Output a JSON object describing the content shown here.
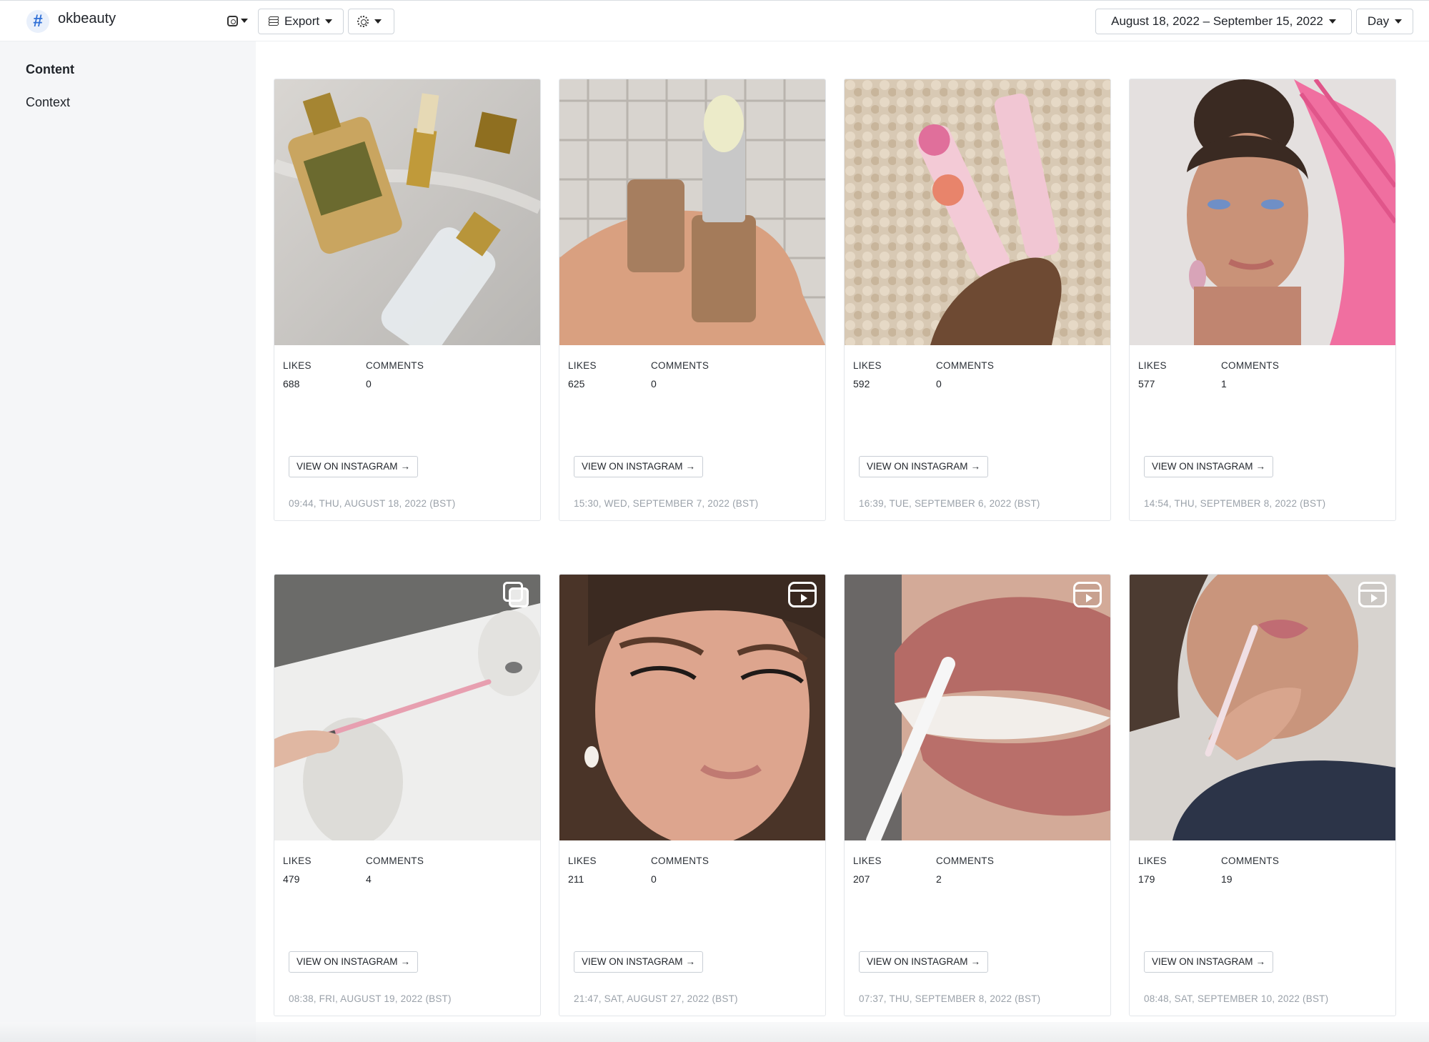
{
  "header": {
    "brand": "okbeauty",
    "export_label": "Export",
    "date_range": "August 18, 2022 – September 15, 2022",
    "granularity": "Day"
  },
  "sidebar": {
    "items": [
      {
        "label": "Content",
        "active": true
      },
      {
        "label": "Context",
        "active": false
      }
    ]
  },
  "labels": {
    "likes": "LIKES",
    "comments": "COMMENTS",
    "view": "VIEW ON INSTAGRAM"
  },
  "posts": [
    {
      "likes": "688",
      "comments": "0",
      "posted": "09:44, THU, AUGUST 18, 2022 (BST)",
      "badge": "",
      "image": "tom-ford-bottles-on-marble"
    },
    {
      "likes": "625",
      "comments": "0",
      "posted": "15:30, WED, SEPTEMBER 7, 2022 (BST)",
      "badge": "",
      "image": "hand-holding-tan-lip-balm"
    },
    {
      "likes": "592",
      "comments": "0",
      "posted": "16:39, TUE, SEPTEMBER 6, 2022 (BST)",
      "badge": "",
      "image": "glossier-tubes-on-fluffy-rug"
    },
    {
      "likes": "577",
      "comments": "1",
      "posted": "14:54, THU, SEPTEMBER 8, 2022 (BST)",
      "badge": "",
      "image": "woman-with-pink-fabric"
    },
    {
      "likes": "479",
      "comments": "4",
      "posted": "08:38, FRI, AUGUST 19, 2022 (BST)",
      "badge": "carousel-icon",
      "image": "pink-lip-liner-over-sink"
    },
    {
      "likes": "211",
      "comments": "0",
      "posted": "21:47, SAT, AUGUST 27, 2022 (BST)",
      "badge": "reel-icon",
      "image": "makeup-closeup-face"
    },
    {
      "likes": "207",
      "comments": "2",
      "posted": "07:37, THU, SEPTEMBER 8, 2022 (BST)",
      "badge": "reel-icon",
      "image": "lip-liner-on-lips"
    },
    {
      "likes": "179",
      "comments": "19",
      "posted": "08:48, SAT, SEPTEMBER 10, 2022 (BST)",
      "badge": "reel-icon",
      "image": "woman-applying-lip-liner"
    }
  ]
}
